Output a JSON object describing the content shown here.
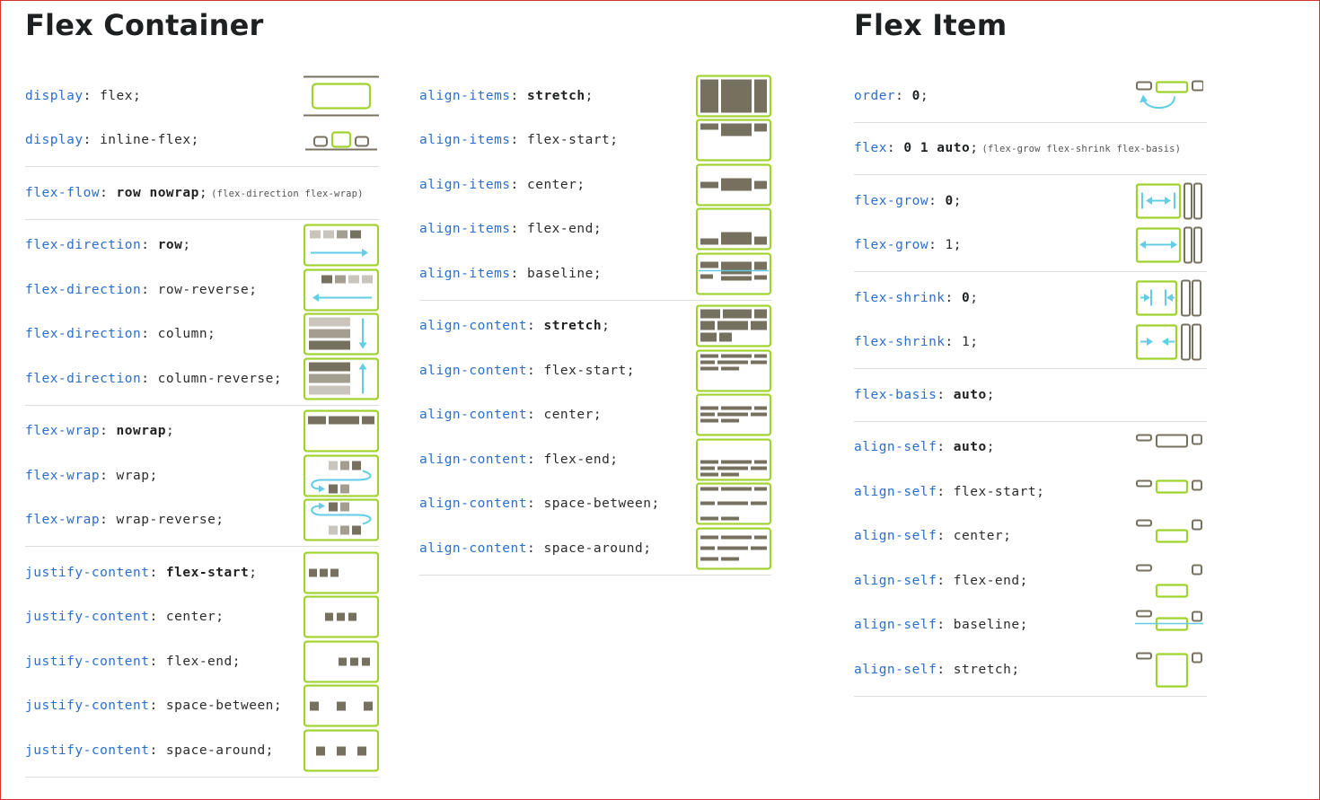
{
  "headings": {
    "container": "Flex Container",
    "item": "Flex Item"
  },
  "colors": {
    "property": "#2b6ecc",
    "accent_green": "#9fd22c",
    "box_fill": "#76705f",
    "arrow_blue": "#63cde6",
    "separator": "#dcdcdc"
  },
  "col1": {
    "g1": [
      {
        "icon": "display-flex-icon",
        "prop": "display",
        "rest": ": flex;"
      },
      {
        "icon": "display-inline-flex-icon",
        "prop": "display",
        "rest": ": inline-flex;"
      }
    ],
    "g2": [
      {
        "icon": "",
        "prop": "flex-flow",
        "sep": ": ",
        "value": "row nowrap",
        "end": ";",
        "note": "(flex-direction flex-wrap)"
      }
    ],
    "g3": [
      {
        "icon": "flex-direction-row-icon",
        "prop": "flex-direction",
        "sep": ": ",
        "value": "row",
        "end": ";"
      },
      {
        "icon": "flex-direction-row-reverse-icon",
        "prop": "flex-direction",
        "rest": ": row-reverse;"
      },
      {
        "icon": "flex-direction-column-icon",
        "prop": "flex-direction",
        "rest": ": column;"
      },
      {
        "icon": "flex-direction-column-reverse-icon",
        "prop": "flex-direction",
        "rest": ": column-reverse;"
      }
    ],
    "g4": [
      {
        "icon": "flex-wrap-nowrap-icon",
        "prop": "flex-wrap",
        "sep": ": ",
        "value": "nowrap",
        "end": ";"
      },
      {
        "icon": "flex-wrap-wrap-icon",
        "prop": "flex-wrap",
        "rest": ": wrap;"
      },
      {
        "icon": "flex-wrap-wrap-reverse-icon",
        "prop": "flex-wrap",
        "rest": ": wrap-reverse;"
      }
    ],
    "g5": [
      {
        "icon": "justify-content-flex-start-icon",
        "prop": "justify-content",
        "sep": ": ",
        "value": "flex-start",
        "end": ";"
      },
      {
        "icon": "justify-content-center-icon",
        "prop": "justify-content",
        "rest": ": center;"
      },
      {
        "icon": "justify-content-flex-end-icon",
        "prop": "justify-content",
        "rest": ": flex-end;"
      },
      {
        "icon": "justify-content-space-between-icon",
        "prop": "justify-content",
        "rest": ": space-between;"
      },
      {
        "icon": "justify-content-space-around-icon",
        "prop": "justify-content",
        "rest": ": space-around;"
      }
    ]
  },
  "col2": {
    "g1": [
      {
        "icon": "align-items-stretch-icon",
        "prop": "align-items",
        "sep": ": ",
        "value": "stretch",
        "end": ";"
      },
      {
        "icon": "align-items-flex-start-icon",
        "prop": "align-items",
        "rest": ": flex-start;"
      },
      {
        "icon": "align-items-center-icon",
        "prop": "align-items",
        "rest": ": center;"
      },
      {
        "icon": "align-items-flex-end-icon",
        "prop": "align-items",
        "rest": ": flex-end;"
      },
      {
        "icon": "align-items-baseline-icon",
        "prop": "align-items",
        "rest": ": baseline;"
      }
    ],
    "g2": [
      {
        "icon": "align-content-stretch-icon",
        "prop": "align-content",
        "sep": ": ",
        "value": "stretch",
        "end": ";"
      },
      {
        "icon": "align-content-flex-start-icon",
        "prop": "align-content",
        "rest": ": flex-start;"
      },
      {
        "icon": "align-content-center-icon",
        "prop": "align-content",
        "rest": ": center;"
      },
      {
        "icon": "align-content-flex-end-icon",
        "prop": "align-content",
        "rest": ": flex-end;"
      },
      {
        "icon": "align-content-space-between-icon",
        "prop": "align-content",
        "rest": ": space-between;"
      },
      {
        "icon": "align-content-space-around-icon",
        "prop": "align-content",
        "rest": ": space-around;"
      }
    ]
  },
  "col3": {
    "g1": [
      {
        "icon": "order-icon",
        "prop": "order",
        "sep": ": ",
        "value": "0",
        "end": ";"
      }
    ],
    "g2": [
      {
        "icon": "",
        "prop": "flex",
        "sep": ": ",
        "value": "0 1 auto",
        "end": ";",
        "note": "(flex-grow flex-shrink flex-basis)"
      }
    ],
    "g3": [
      {
        "icon": "flex-grow-0-icon",
        "prop": "flex-grow",
        "sep": ": ",
        "value": "0",
        "end": ";"
      },
      {
        "icon": "flex-grow-1-icon",
        "prop": "flex-grow",
        "rest": ": 1;"
      }
    ],
    "g4": [
      {
        "icon": "flex-shrink-0-icon",
        "prop": "flex-shrink",
        "sep": ": ",
        "value": "0",
        "end": ";"
      },
      {
        "icon": "flex-shrink-1-icon",
        "prop": "flex-shrink",
        "rest": ": 1;"
      }
    ],
    "g5": [
      {
        "icon": "",
        "prop": "flex-basis",
        "sep": ": ",
        "value": "auto",
        "end": ";"
      }
    ],
    "g6": [
      {
        "icon": "align-self-auto-icon",
        "prop": "align-self",
        "sep": ": ",
        "value": "auto",
        "end": ";"
      },
      {
        "icon": "align-self-flex-start-icon",
        "prop": "align-self",
        "rest": ": flex-start;"
      },
      {
        "icon": "align-self-center-icon",
        "prop": "align-self",
        "rest": ": center;"
      },
      {
        "icon": "align-self-flex-end-icon",
        "prop": "align-self",
        "rest": ": flex-end;"
      },
      {
        "icon": "align-self-baseline-icon",
        "prop": "align-self",
        "rest": ": baseline;"
      },
      {
        "icon": "align-self-stretch-icon",
        "prop": "align-self",
        "rest": ": stretch;"
      }
    ]
  }
}
